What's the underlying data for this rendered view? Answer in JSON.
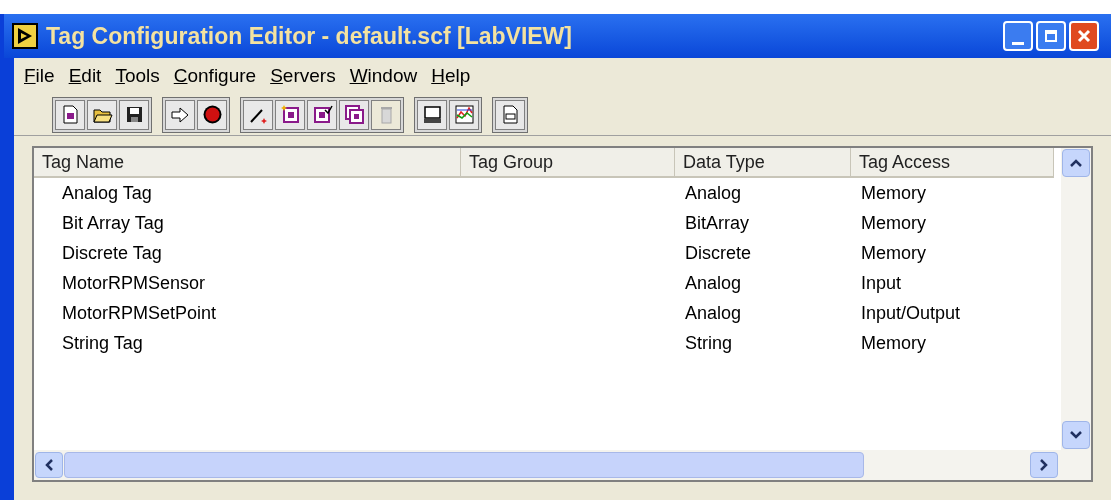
{
  "window": {
    "title": "Tag Configuration Editor - default.scf [LabVIEW]"
  },
  "menu": [
    "File",
    "Edit",
    "Tools",
    "Configure",
    "Servers",
    "Window",
    "Help"
  ],
  "toolbar": [
    [
      {
        "kind": "new",
        "disabled": false
      },
      {
        "kind": "open",
        "disabled": false
      },
      {
        "kind": "save",
        "disabled": false
      }
    ],
    [
      {
        "kind": "deploy",
        "disabled": false
      },
      {
        "kind": "stop",
        "disabled": false
      }
    ],
    [
      {
        "kind": "wand",
        "disabled": false
      },
      {
        "kind": "add",
        "disabled": false
      },
      {
        "kind": "edit",
        "disabled": false
      },
      {
        "kind": "copy",
        "disabled": false
      },
      {
        "kind": "delete",
        "disabled": true
      }
    ],
    [
      {
        "kind": "monitor",
        "disabled": false
      },
      {
        "kind": "chart",
        "disabled": false
      }
    ],
    [
      {
        "kind": "vi",
        "disabled": false
      }
    ]
  ],
  "table": {
    "columns": [
      "Tag Name",
      "Tag Group",
      "Data Type",
      "Tag Access"
    ],
    "rows": [
      [
        "Analog Tag",
        "",
        "Analog",
        "Memory"
      ],
      [
        "Bit Array Tag",
        "",
        "BitArray",
        "Memory"
      ],
      [
        "Discrete Tag",
        "",
        "Discrete",
        "Memory"
      ],
      [
        "MotorRPMSensor",
        "",
        "Analog",
        "Input"
      ],
      [
        "MotorRPMSetPoint",
        "",
        "Analog",
        "Input/Output"
      ],
      [
        "String Tag",
        "",
        "String",
        "Memory"
      ]
    ]
  }
}
